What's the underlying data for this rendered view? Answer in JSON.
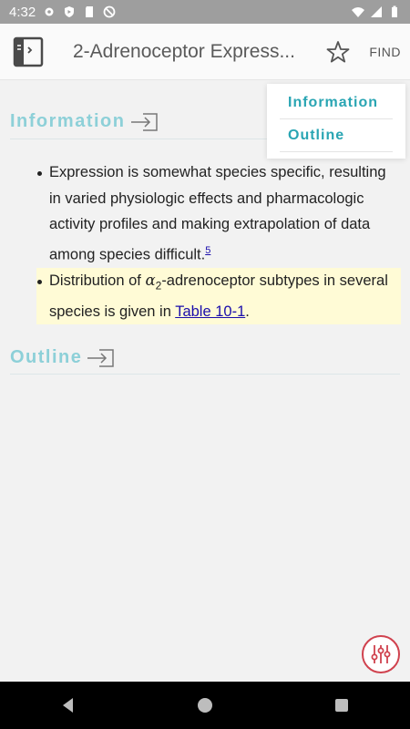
{
  "status_bar": {
    "time": "4:32",
    "left_icons": [
      "gear-icon",
      "shield-icon",
      "sd-card-icon",
      "no-disturb-icon"
    ],
    "right_icons": [
      "wifi-icon",
      "signal-icon",
      "battery-icon"
    ]
  },
  "app_bar": {
    "title": "2-Adrenoceptor Express...",
    "find_label": "FIND",
    "book_icon": "book-icon",
    "star_icon": "star-outline-icon"
  },
  "sections": {
    "information": {
      "heading": "Information"
    },
    "outline": {
      "heading": "Outline"
    }
  },
  "bullets": [
    {
      "text": "Expression is somewhat species specific, resulting in varied physiologic effects and pharmacologic activity profiles and making extrapolation of data among species difficult.",
      "ref": "5"
    },
    {
      "prefix": "Distribution of ",
      "alpha": "α",
      "alpha_sub": "2",
      "middle": "-adrenoceptor subtypes in several species is given in ",
      "link": "Table 10-1",
      "suffix": "."
    }
  ],
  "toc_popup": {
    "items": [
      "Information",
      "Outline"
    ]
  },
  "fab": {
    "icon": "sliders-icon"
  },
  "nav_bar": {
    "icons": [
      "back-icon",
      "home-icon",
      "recents-icon"
    ]
  }
}
